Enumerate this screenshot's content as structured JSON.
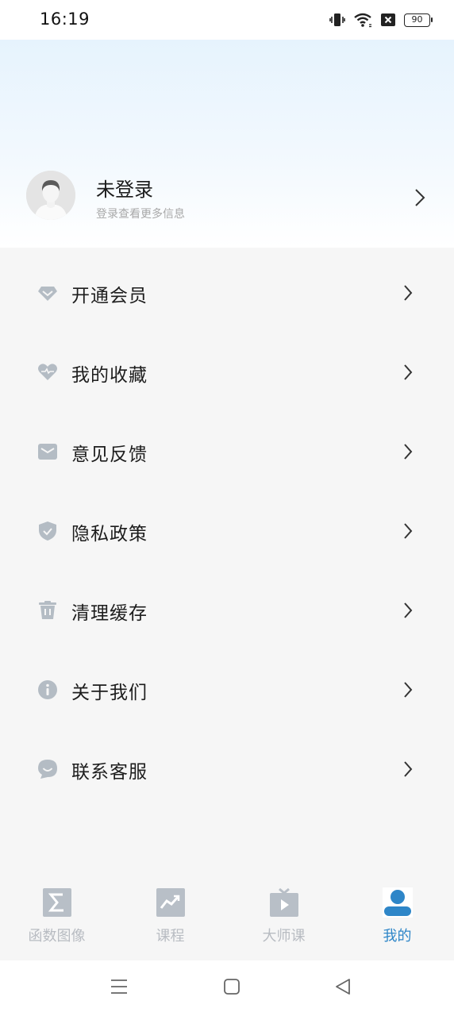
{
  "status_bar": {
    "time": "16:19",
    "battery": "90",
    "icons": [
      "vibrate-icon",
      "wifi-icon",
      "no-sim-icon",
      "battery-icon"
    ]
  },
  "profile": {
    "name": "未登录",
    "subtitle": "登录查看更多信息",
    "avatar": "default-avatar"
  },
  "menu": {
    "items": [
      {
        "label": "开通会员",
        "icon": "diamond-icon"
      },
      {
        "label": "我的收藏",
        "icon": "heart-icon"
      },
      {
        "label": "意见反馈",
        "icon": "mail-icon"
      },
      {
        "label": "隐私政策",
        "icon": "shield-icon"
      },
      {
        "label": "清理缓存",
        "icon": "trash-icon"
      },
      {
        "label": "关于我们",
        "icon": "info-icon"
      },
      {
        "label": "联系客服",
        "icon": "chat-icon"
      }
    ]
  },
  "tabbar": {
    "tabs": [
      {
        "label": "函数图像",
        "icon": "sigma-icon",
        "active": false
      },
      {
        "label": "课程",
        "icon": "trend-chart-icon",
        "active": false
      },
      {
        "label": "大师课",
        "icon": "tv-play-icon",
        "active": false
      },
      {
        "label": "我的",
        "icon": "user-icon",
        "active": true
      }
    ]
  },
  "colors": {
    "accent": "#2e86c8",
    "icon_gray": "#b4bcc4",
    "tab_inactive": "#b8bcc2",
    "background": "#f6f6f6"
  }
}
